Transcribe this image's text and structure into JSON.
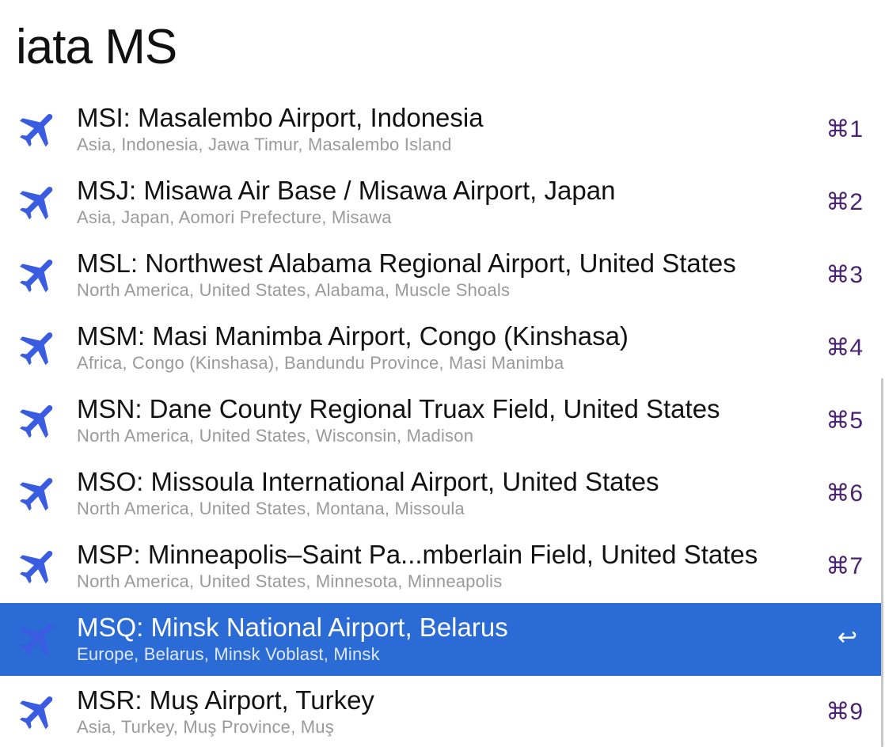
{
  "query": "iata MS",
  "colors": {
    "accent": "#2b6bd6",
    "icon": "#3a5ce0",
    "shortcut": "#4a2472"
  },
  "results": [
    {
      "title": "MSI: Masalembo Airport, Indonesia",
      "subtitle": "Asia, Indonesia, Jawa Timur, Masalembo Island",
      "shortcut": "⌘1",
      "icon": "airplane-icon"
    },
    {
      "title": "MSJ: Misawa Air Base / Misawa Airport, Japan",
      "subtitle": "Asia, Japan, Aomori Prefecture, Misawa",
      "shortcut": "⌘2",
      "icon": "airplane-icon"
    },
    {
      "title": "MSL: Northwest Alabama Regional Airport, United States",
      "subtitle": "North America, United States, Alabama, Muscle Shoals",
      "shortcut": "⌘3",
      "icon": "airplane-icon"
    },
    {
      "title": "MSM: Masi Manimba Airport, Congo (Kinshasa)",
      "subtitle": "Africa, Congo (Kinshasa), Bandundu Province, Masi Manimba",
      "shortcut": "⌘4",
      "icon": "airplane-icon"
    },
    {
      "title": "MSN: Dane County Regional Truax Field, United States",
      "subtitle": "North America, United States, Wisconsin, Madison",
      "shortcut": "⌘5",
      "icon": "airplane-icon"
    },
    {
      "title": "MSO: Missoula International Airport, United States",
      "subtitle": "North America, United States, Montana, Missoula",
      "shortcut": "⌘6",
      "icon": "airplane-icon"
    },
    {
      "title": "MSP: Minneapolis–Saint Pa...mberlain Field, United States",
      "subtitle": "North America, United States, Minnesota, Minneapolis",
      "shortcut": "⌘7",
      "icon": "airplane-icon"
    },
    {
      "title": "MSQ: Minsk National Airport, Belarus",
      "subtitle": "Europe, Belarus, Minsk Voblast, Minsk",
      "shortcut": "↩",
      "icon": "airplane-icon",
      "selected": true
    },
    {
      "title": "MSR: Muş Airport, Turkey",
      "subtitle": "Asia, Turkey, Muş Province, Muş",
      "shortcut": "⌘9",
      "icon": "airplane-icon"
    }
  ]
}
